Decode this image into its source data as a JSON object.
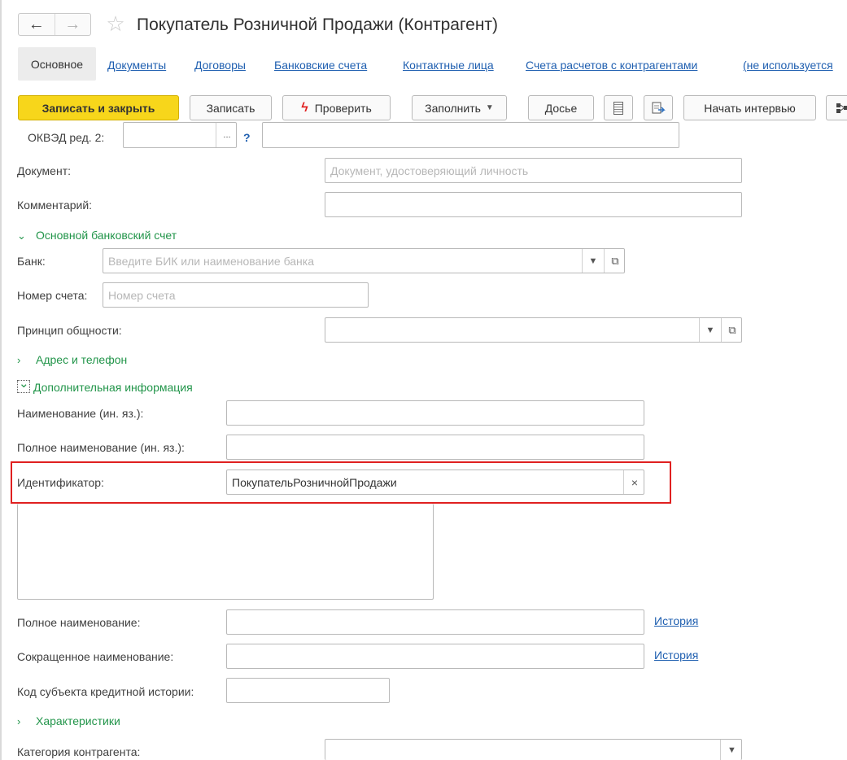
{
  "title": "Покупатель Розничной Продажи (Контрагент)",
  "icons": {
    "back": "arrow-left-icon",
    "forward": "arrow-right-icon",
    "favorite": "star-icon"
  },
  "tabs": [
    "Основное",
    "Документы",
    "Договоры",
    "Банковские счета",
    "Контактные лица",
    "Счета расчетов с контрагентами",
    "(не используется"
  ],
  "toolbar": {
    "save_close": "Записать и закрыть",
    "save": "Записать",
    "check": "Проверить",
    "fill": "Заполнить",
    "dossier": "Досье",
    "interview": "Начать интервью"
  },
  "form": {
    "okved_label": "ОКВЭД ред. 2:",
    "okved_select": "...",
    "okved_help": "?",
    "document_label": "Документ:",
    "document_placeholder": "Документ, удостоверяющий личность",
    "comment_label": "Комментарий:",
    "section_bank": "Основной банковский счет",
    "bank_label": "Банк:",
    "bank_placeholder": "Введите БИК или наименование банка",
    "account_label": "Номер счета:",
    "account_placeholder": "Номер счета",
    "principle_label": "Принцип общности:",
    "section_address": "Адрес и телефон",
    "section_additional": "Дополнительная информация",
    "name_foreign_label": "Наименование (ин. яз.):",
    "full_name_foreign_label": "Полное наименование (ин. яз.):",
    "identifier_label": "Идентификатор:",
    "identifier_value": "ПокупательРозничнойПродажи",
    "clear_glyph": "×",
    "full_name_label": "Полное наименование:",
    "history_label": "История",
    "short_name_label": "Сокращенное наименование:",
    "credit_code_label": "Код субъекта кредитной истории:",
    "section_characteristics": "Характеристики",
    "category_label": "Категория контрагента:"
  }
}
